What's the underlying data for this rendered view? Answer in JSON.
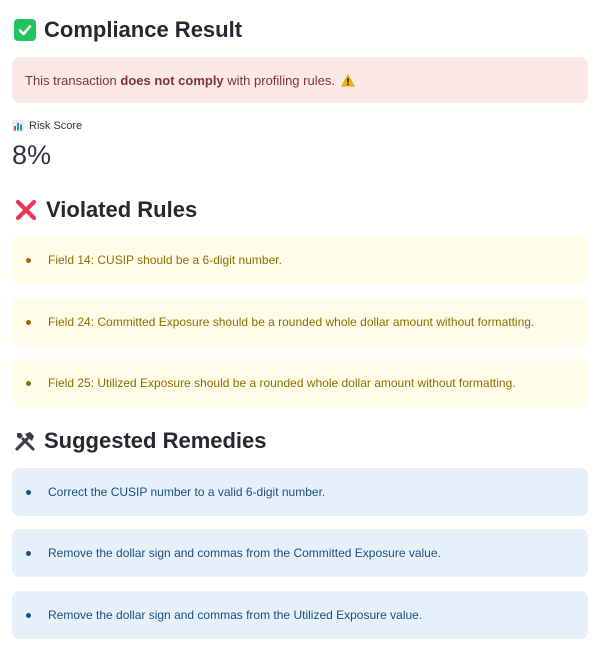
{
  "compliance": {
    "title": "Compliance Result",
    "alert_prefix": "This transaction ",
    "alert_bold": "does not comply",
    "alert_suffix": " with profiling rules.",
    "alert_icon": "warning-icon"
  },
  "risk": {
    "label": "Risk Score",
    "label_icon": "bar-chart-icon",
    "value": "8%"
  },
  "violated": {
    "title": "Violated Rules",
    "icon": "cross-mark-icon",
    "items": [
      "Field 14: CUSIP should be a 6-digit number.",
      "Field 24: Committed Exposure should be a rounded whole dollar amount without formatting.",
      "Field 25: Utilized Exposure should be a rounded whole dollar amount without formatting."
    ]
  },
  "remedies": {
    "title": "Suggested Remedies",
    "icon": "tools-icon",
    "items": [
      "Correct the CUSIP number to a valid 6-digit number.",
      "Remove the dollar sign and commas from the Committed Exposure value.",
      "Remove the dollar sign and commas from the Utilized Exposure value."
    ]
  },
  "colors": {
    "success": "#21c55d",
    "error_bg": "#fde8e8",
    "warning_bg": "#fffce7",
    "info_bg": "#e6f0fb"
  }
}
